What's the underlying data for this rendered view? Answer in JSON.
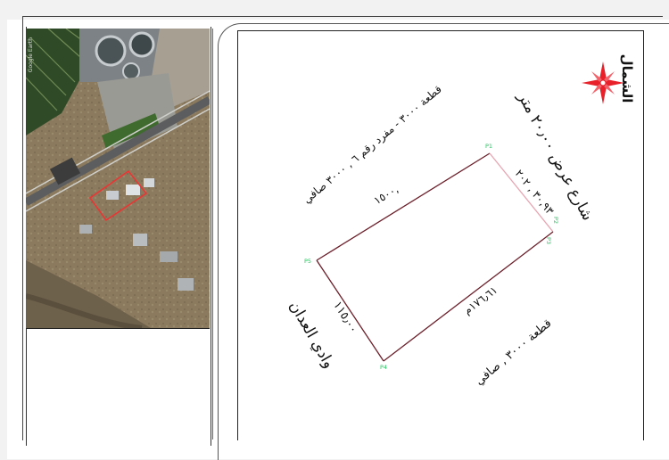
{
  "north": {
    "label": "الشمال",
    "icon": "compass-rose-icon",
    "color": "#e8202a"
  },
  "aerial": {
    "watermark": "Google Earth"
  },
  "plot": {
    "color_lines": "#6b1f2a",
    "color_points": "#22c55e",
    "points": [
      "P1",
      "P2",
      "P3",
      "P4",
      "P5"
    ],
    "edges": {
      "top": "١٥٠٠,",
      "right": "٣٠,٩٣ , ٢٠٢",
      "bottom": "١٧٦٫٦١م",
      "left": "١١٥٫٠٠"
    }
  },
  "annotations": {
    "street_north": "شارع عرض ٢٠٫٠٠ متر",
    "neighbor_top_left": "قطعة ٣٠٠٠ - مفرد رقم ٦ , ٣٠٠٠ صافي",
    "neighbor_bottom_right": "قطعة ٣٠٠٠ , صافي",
    "wadi": "وادي العدان"
  }
}
